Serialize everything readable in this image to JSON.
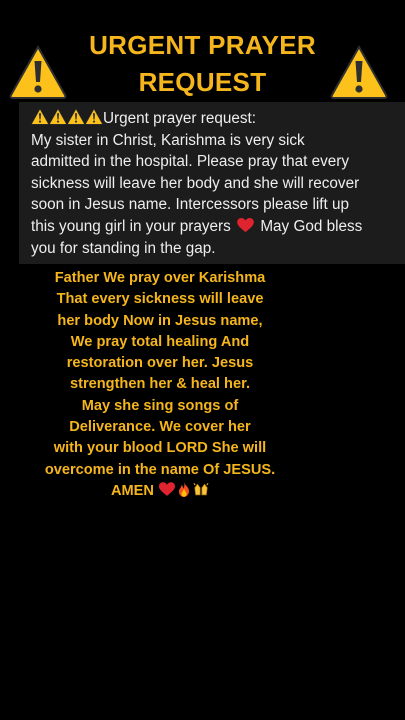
{
  "title": {
    "line1": "URGENT PRAYER",
    "line2": "REQUEST"
  },
  "post": {
    "lines": [
      "Urgent prayer request:",
      "My sister in Christ, Karishma is very sick",
      "admitted in the hospital. Please pray that every",
      "sickness will leave her body and she will recover",
      "soon in Jesus name. Intercessors please lift up",
      "this young girl in your prayers",
      "May God bless",
      "you for standing in the gap."
    ]
  },
  "prayer": {
    "lines": [
      "Father We pray over Karishma",
      "That every sickness will leave",
      "her body Now in Jesus name,",
      "We pray total  healing And",
      "restoration over her.  Jesus",
      "strengthen her & heal her.",
      "May she sing songs of",
      "Deliverance.  We cover her",
      "with your blood LORD  She will",
      "overcome in  the name Of JESUS.",
      "AMEN"
    ]
  },
  "icons": {
    "warning": "warning-icon",
    "heart": "red-heart-icon",
    "fire": "fire-icon",
    "hands": "raised-hands-icon"
  },
  "colors": {
    "background": "#000000",
    "title": "#f5b51c",
    "post_background": "#1c1c1c",
    "post_text": "#eeeeee",
    "prayer_text": "#f5b51c",
    "warning_fill": "#fcc21b"
  }
}
